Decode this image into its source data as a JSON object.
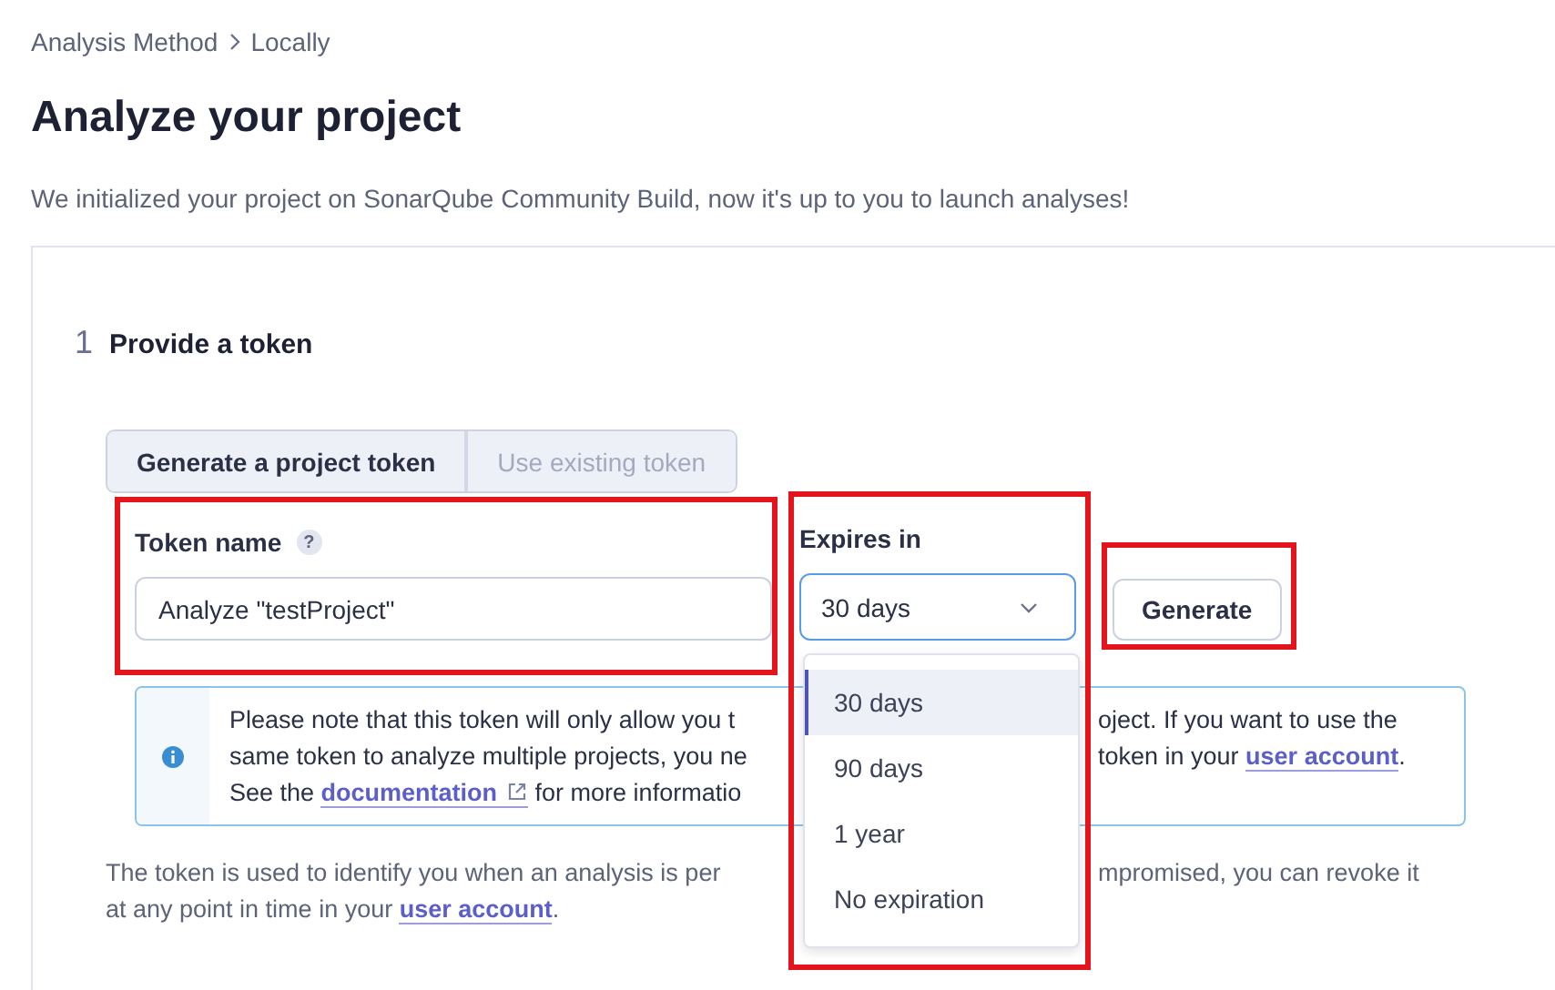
{
  "breadcrumb": [
    {
      "label": "Analysis Method"
    },
    {
      "label": "Locally"
    }
  ],
  "title": "Analyze your project",
  "description": "We initialized your project on SonarQube Community Build, now it's up to you to launch analyses!",
  "step": {
    "number": "1",
    "title": "Provide a token"
  },
  "token_tabs": [
    {
      "label": "Generate a project token",
      "selected": true
    },
    {
      "label": "Use existing token",
      "selected": false
    }
  ],
  "token_name": {
    "label": "Token name",
    "help": "?",
    "value": "Analyze \"testProject\""
  },
  "expires": {
    "label": "Expires in",
    "value": "30 days",
    "expanded": true,
    "options": [
      {
        "label": "30 days",
        "selected": true
      },
      {
        "label": "90 days",
        "selected": false
      },
      {
        "label": "1 year",
        "selected": false
      },
      {
        "label": "No expiration",
        "selected": false
      }
    ]
  },
  "generate_button": "Generate",
  "info_box": {
    "lines": [
      {
        "left": [
          {
            "kind": "text",
            "text": "Please note that this token will only allow you t"
          }
        ],
        "right": [
          {
            "kind": "text",
            "text": "oject. If you want to use the"
          }
        ]
      },
      {
        "left": [
          {
            "kind": "text",
            "text": "same token to analyze multiple projects, you ne"
          }
        ],
        "right": [
          {
            "kind": "text",
            "text": "token in your "
          },
          {
            "kind": "link",
            "text": "user account"
          },
          {
            "kind": "text",
            "text": "."
          }
        ]
      },
      {
        "left": [
          {
            "kind": "text",
            "text": "See the "
          },
          {
            "kind": "external_link",
            "text": "documentation"
          },
          {
            "kind": "text",
            "text": " for more informatio"
          }
        ]
      }
    ]
  },
  "footer": {
    "lines": [
      {
        "left": [
          {
            "kind": "text",
            "text": "The token is used to identify you when an analysis is per"
          }
        ],
        "right": [
          {
            "kind": "text",
            "text": "mpromised, you can revoke it"
          }
        ]
      },
      {
        "left": [
          {
            "kind": "text",
            "text": "at any point in time in your "
          },
          {
            "kind": "link",
            "text": "user account"
          },
          {
            "kind": "text",
            "text": "."
          }
        ]
      }
    ]
  }
}
